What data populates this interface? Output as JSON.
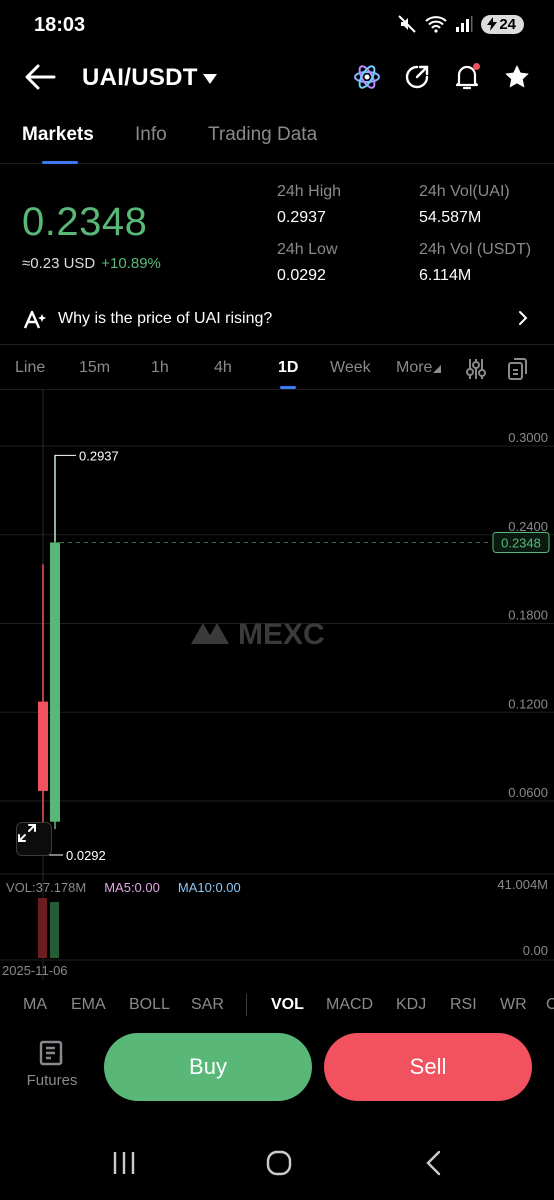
{
  "status": {
    "time": "18:03",
    "battery": "24"
  },
  "header": {
    "pair": "UAI/USDT"
  },
  "tabs": [
    "Markets",
    "Info",
    "Trading Data"
  ],
  "price": {
    "last": "0.2348",
    "usd": "≈0.23 USD",
    "change": "+10.89%"
  },
  "stats": {
    "high_label": "24h High",
    "high": "0.2937",
    "low_label": "24h Low",
    "low": "0.0292",
    "vol_base_label": "24h Vol(UAI)",
    "vol_base": "54.587M",
    "vol_quote_label": "24h Vol (USDT)",
    "vol_quote": "6.114M"
  },
  "why": {
    "text": "Why is the price of UAI rising?"
  },
  "intervals": [
    "Line",
    "15m",
    "1h",
    "4h",
    "1D",
    "Week",
    "More"
  ],
  "active_interval": "1D",
  "chart": {
    "watermark": "MEXC",
    "y_ticks": [
      "0.3000",
      "0.2400",
      "0.1800",
      "0.1200",
      "0.0600"
    ],
    "y_tick_values": [
      0.3,
      0.24,
      0.18,
      0.12,
      0.06
    ],
    "current_price_tag": "0.2348",
    "current_price": 0.2348,
    "high_marker": "0.2937",
    "low_marker": "0.0292",
    "candles": [
      {
        "open": 0.1272,
        "high": 0.22,
        "low": 0.0292,
        "close": 0.0668,
        "color": "#f2525f"
      },
      {
        "open": 0.046,
        "high": 0.2937,
        "low": 0.041,
        "close": 0.2348,
        "color": "#59b877"
      }
    ],
    "colors": {
      "up": "#59b877",
      "down": "#f2525f"
    }
  },
  "volume": {
    "vol_text": "VOL:37.178M",
    "ma5": "MA5:0.00",
    "ma10": "MA10:0.00",
    "max": "41.004M",
    "zero": "0.00",
    "date": "2025-11-06"
  },
  "indicators": [
    "MA",
    "EMA",
    "BOLL",
    "SAR",
    "VOL",
    "MACD",
    "KDJ",
    "RSI",
    "WR",
    "O"
  ],
  "active_indicator": "VOL",
  "actions": {
    "futures": "Futures",
    "buy": "Buy",
    "sell": "Sell"
  }
}
